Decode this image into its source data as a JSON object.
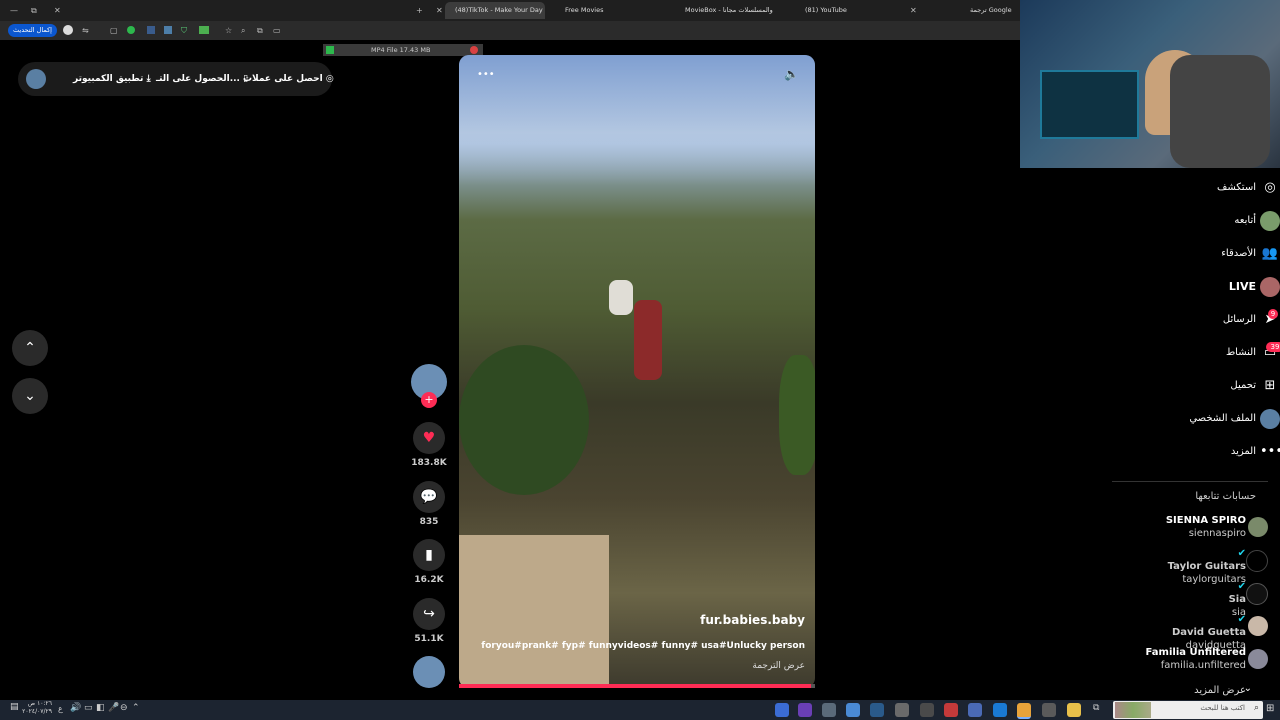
{
  "browser": {
    "tabs": [
      {
        "label": "(48)TikTok - Make Your Day",
        "active": true
      },
      {
        "label": "Free Movies",
        "active": false
      },
      {
        "label": "MovieBox - والمسلسلات مجانا",
        "active": false
      },
      {
        "label": "(81) YouTube",
        "active": false
      },
      {
        "label": "ترجمة Google",
        "active": false
      }
    ],
    "update_label": "إكمال التحديث",
    "download_label": "MP4 File 17.43 MB"
  },
  "topbar": {
    "coins": "احصل على عملات",
    "get_on": "الحصول على التـ...",
    "desktop_app": "تطبيق الكمبيوتر"
  },
  "video": {
    "author": "fur.babies.baby",
    "caption": "foryou#prank# fyp# funnyvideos# funny# usa#Unlucky person",
    "translate": "عرض الترجمة",
    "progress": 0.99
  },
  "actions": {
    "likes": "183.8K",
    "comments": "835",
    "saves": "16.2K",
    "shares": "51.1K"
  },
  "sidebar": {
    "explore": "استكشف",
    "following": "أتابعه",
    "friends": "الأصدقاء",
    "live": "LIVE",
    "messages": "الرسائل",
    "messages_badge": "9",
    "activity": "النشاط",
    "activity_badge": "39",
    "upload": "تحميل",
    "profile": "الملف الشخصي",
    "more": "المزيد",
    "following_header": "حسابات تتابعها",
    "accounts": [
      {
        "name": "SIENNA SPIRO",
        "handle": "siennaspiro"
      },
      {
        "name": "Taylor Guitars",
        "handle": "taylorguitars"
      },
      {
        "name": "Sia",
        "handle": "sia"
      },
      {
        "name": "David Guetta",
        "handle": "davidguetta"
      },
      {
        "name": "Familia Unfiltered",
        "handle": "familia.unfiltered"
      }
    ],
    "see_more": "عرض المزيد"
  },
  "taskbar": {
    "search_placeholder": "اكتب هنا للبحث",
    "time": "١٠:٢٦ ص",
    "date": "٢٠٢٤/٠٧/٢٩"
  },
  "colors": {
    "accent": "#fe2c55",
    "background": "#000000",
    "chrome": "#1f1f1f"
  }
}
